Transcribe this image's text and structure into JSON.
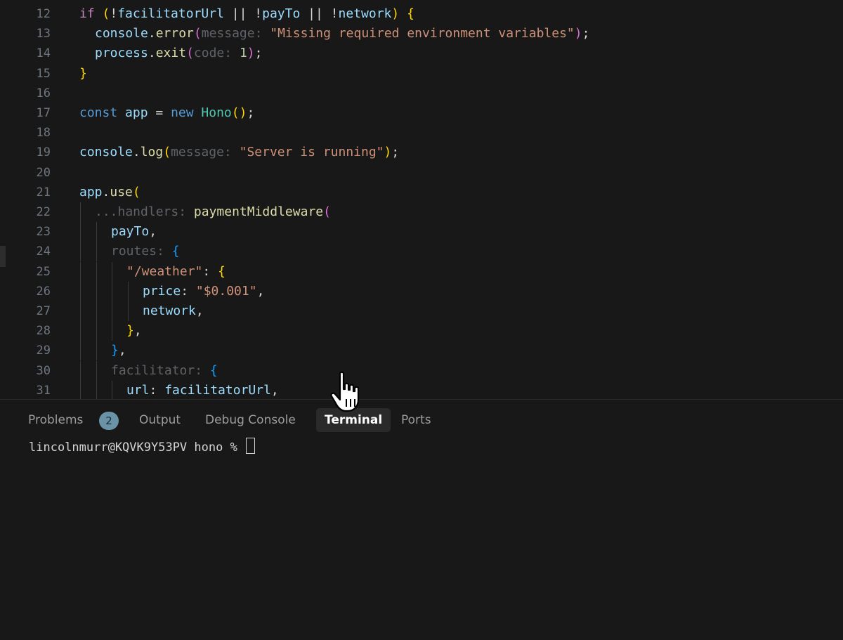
{
  "editor": {
    "lines": [
      {
        "n": "12",
        "indent": 0,
        "guides": [],
        "tokens": [
          [
            "if ",
            "#c586c0"
          ],
          [
            "(",
            "#ffd700"
          ],
          [
            "!",
            "#d4d4d4"
          ],
          [
            "facilitatorUrl",
            "#9cdcfe"
          ],
          [
            " || ",
            "#d4d4d4"
          ],
          [
            "!",
            "#d4d4d4"
          ],
          [
            "payTo",
            "#9cdcfe"
          ],
          [
            " || ",
            "#d4d4d4"
          ],
          [
            "!",
            "#d4d4d4"
          ],
          [
            "network",
            "#9cdcfe"
          ],
          [
            ") ",
            "#ffd700"
          ],
          [
            "{",
            "#ffd700"
          ]
        ]
      },
      {
        "n": "13",
        "indent": 22,
        "guides": [],
        "tokens": [
          [
            "console",
            "#9cdcfe"
          ],
          [
            ".",
            "#d4d4d4"
          ],
          [
            "error",
            "#dcdcaa"
          ],
          [
            "(",
            "#da70d6"
          ],
          [
            "message: ",
            "#5f6368"
          ],
          [
            "\"Missing required environment variables\"",
            "#ce9178"
          ],
          [
            ")",
            "#da70d6"
          ],
          [
            ";",
            "#d4d4d4"
          ]
        ]
      },
      {
        "n": "14",
        "indent": 22,
        "guides": [],
        "tokens": [
          [
            "process",
            "#9cdcfe"
          ],
          [
            ".",
            "#d4d4d4"
          ],
          [
            "exit",
            "#dcdcaa"
          ],
          [
            "(",
            "#da70d6"
          ],
          [
            "code: ",
            "#5f6368"
          ],
          [
            "1",
            "#b5cea8"
          ],
          [
            ")",
            "#da70d6"
          ],
          [
            ";",
            "#d4d4d4"
          ]
        ]
      },
      {
        "n": "15",
        "indent": 0,
        "guides": [],
        "tokens": [
          [
            "}",
            "#ffd700"
          ]
        ]
      },
      {
        "n": "16",
        "indent": 0,
        "guides": [],
        "tokens": []
      },
      {
        "n": "17",
        "indent": 0,
        "guides": [],
        "tokens": [
          [
            "const ",
            "#569cd6"
          ],
          [
            "app",
            "#9cdcfe"
          ],
          [
            " = ",
            "#d4d4d4"
          ],
          [
            "new ",
            "#569cd6"
          ],
          [
            "Hono",
            "#4ec9b0"
          ],
          [
            "()",
            "#ffd700"
          ],
          [
            ";",
            "#d4d4d4"
          ]
        ]
      },
      {
        "n": "18",
        "indent": 0,
        "guides": [],
        "tokens": []
      },
      {
        "n": "19",
        "indent": 0,
        "guides": [],
        "tokens": [
          [
            "console",
            "#9cdcfe"
          ],
          [
            ".",
            "#d4d4d4"
          ],
          [
            "log",
            "#dcdcaa"
          ],
          [
            "(",
            "#ffd700"
          ],
          [
            "message: ",
            "#5f6368"
          ],
          [
            "\"Server is running\"",
            "#ce9178"
          ],
          [
            ")",
            "#ffd700"
          ],
          [
            ";",
            "#d4d4d4"
          ]
        ]
      },
      {
        "n": "20",
        "indent": 0,
        "guides": [],
        "tokens": []
      },
      {
        "n": "21",
        "indent": 0,
        "guides": [],
        "tokens": [
          [
            "app",
            "#9cdcfe"
          ],
          [
            ".",
            "#d4d4d4"
          ],
          [
            "use",
            "#dcdcaa"
          ],
          [
            "(",
            "#ffd700"
          ]
        ]
      },
      {
        "n": "22",
        "indent": 22,
        "guides": [
          114
        ],
        "tokens": [
          [
            "...handlers: ",
            "#5f6368"
          ],
          [
            "paymentMiddleware",
            "#dcdcaa"
          ],
          [
            "(",
            "#da70d6"
          ]
        ]
      },
      {
        "n": "23",
        "indent": 45,
        "guides": [
          114,
          137
        ],
        "tokens": [
          [
            "payTo",
            "#9cdcfe"
          ],
          [
            ",",
            "#d4d4d4"
          ]
        ]
      },
      {
        "n": "24",
        "indent": 45,
        "guides": [
          114,
          137
        ],
        "tokens": [
          [
            "routes: ",
            "#5f6368"
          ],
          [
            "{",
            "#179fff"
          ]
        ]
      },
      {
        "n": "25",
        "indent": 67,
        "guides": [
          114,
          137,
          159
        ],
        "tokens": [
          [
            "\"/weather\"",
            "#ce9178"
          ],
          [
            ": ",
            "#d4d4d4"
          ],
          [
            "{",
            "#ffd700"
          ]
        ]
      },
      {
        "n": "26",
        "indent": 90,
        "guides": [
          114,
          137,
          159,
          182
        ],
        "tokens": [
          [
            "price",
            "#9cdcfe"
          ],
          [
            ": ",
            "#d4d4d4"
          ],
          [
            "\"$0.001\"",
            "#ce9178"
          ],
          [
            ",",
            "#d4d4d4"
          ]
        ]
      },
      {
        "n": "27",
        "indent": 90,
        "guides": [
          114,
          137,
          159,
          182
        ],
        "tokens": [
          [
            "network",
            "#9cdcfe"
          ],
          [
            ",",
            "#d4d4d4"
          ]
        ]
      },
      {
        "n": "28",
        "indent": 67,
        "guides": [
          114,
          137,
          159
        ],
        "tokens": [
          [
            "}",
            "#ffd700"
          ],
          [
            ",",
            "#d4d4d4"
          ]
        ]
      },
      {
        "n": "29",
        "indent": 45,
        "guides": [
          114,
          137
        ],
        "tokens": [
          [
            "}",
            "#179fff"
          ],
          [
            ",",
            "#d4d4d4"
          ]
        ]
      },
      {
        "n": "30",
        "indent": 45,
        "guides": [
          114,
          137
        ],
        "tokens": [
          [
            "facilitator: ",
            "#5f6368"
          ],
          [
            "{",
            "#179fff"
          ]
        ]
      },
      {
        "n": "31",
        "indent": 67,
        "guides": [
          114,
          137,
          159
        ],
        "tokens": [
          [
            "url",
            "#9cdcfe"
          ],
          [
            ": ",
            "#d4d4d4"
          ],
          [
            "facilitatorUrl",
            "#9cdcfe"
          ],
          [
            ",",
            "#d4d4d4"
          ]
        ]
      }
    ]
  },
  "panel": {
    "tabs": [
      {
        "label": "Problems",
        "name": "tab-problems"
      },
      {
        "label": "Output",
        "name": "tab-output"
      },
      {
        "label": "Debug Console",
        "name": "tab-debug-console"
      },
      {
        "label": "Terminal",
        "name": "tab-terminal"
      },
      {
        "label": "Ports",
        "name": "tab-ports"
      }
    ],
    "active_tab": "Terminal",
    "problems_count": "2",
    "terminal_prompt": "lincolnmurr@KQVK9Y53PV hono % "
  },
  "colors": {
    "background": "#181818",
    "active_tab_bg": "#2a2a2a",
    "badge": "#6b93a8"
  },
  "icons": {
    "pointer": "hand-pointer-icon"
  }
}
